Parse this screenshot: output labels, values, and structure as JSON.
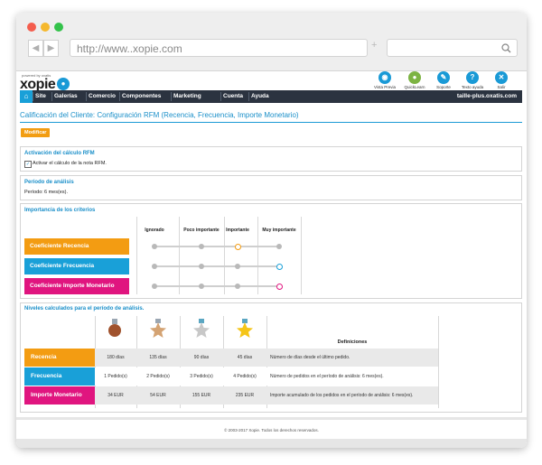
{
  "browser": {
    "url": "http://www..xopie.com",
    "traffic_colors": [
      "#f45d4d",
      "#f5b82d",
      "#33c24a"
    ]
  },
  "header": {
    "logo_small": "powered by oxatis",
    "logo": "xopie",
    "icons": [
      {
        "label": "Vista Previa",
        "icon": "preview-icon",
        "color": "#1a9ad6"
      },
      {
        "label": "QuickLearn",
        "icon": "user-icon",
        "color": "#7cb342"
      },
      {
        "label": "Soporte",
        "icon": "wrench-icon",
        "color": "#1a9ad6"
      },
      {
        "label": "Texto ayuda",
        "icon": "help-icon",
        "color": "#1a9ad6"
      },
      {
        "label": "Salir",
        "icon": "close-icon",
        "color": "#1a9ad6"
      }
    ]
  },
  "menu": {
    "items": [
      "Site",
      "Galerías",
      "Comercio",
      "Componentes",
      "Marketing",
      "Cuenta",
      "Ayuda"
    ],
    "site_name": "taille-plus.oxatis.com"
  },
  "page_title": "Calificación del Cliente: Configuración RFM (Recencia, Frecuencia, Importe Monetario)",
  "modify_button": "Modificar",
  "activation": {
    "title": "Activación del cálculo RFM",
    "checkbox_label": "Activar el cálculo de la nota RFM.",
    "checked": true
  },
  "period": {
    "title": "Período de análisis",
    "label": "Período:",
    "value": "6 mes(es)."
  },
  "importance": {
    "title": "Importancia de los criterios",
    "levels": [
      "Ignorado",
      "Poco importante",
      "Importante",
      "Muy importante"
    ],
    "criteria": [
      {
        "label": "Coeficiente Recencia",
        "color": "#f39c12",
        "selected_level": 2
      },
      {
        "label": "Coeficiente Frecuencia",
        "color": "#19a0d8",
        "selected_level": 3
      },
      {
        "label": "Coeficiente Importe Monetario",
        "color": "#e0157f",
        "selected_level": 3
      }
    ]
  },
  "levels": {
    "title": "Niveles calculados para el período de análisis.",
    "medals": [
      {
        "icon": "bronze-medal-icon",
        "color": "#a0522d"
      },
      {
        "icon": "bronze-star-icon",
        "color": "#d4a373"
      },
      {
        "icon": "silver-star-icon",
        "color": "#c8c8c8"
      },
      {
        "icon": "gold-star-icon",
        "color": "#f5c518"
      }
    ],
    "definitions_header": "Definiciones",
    "rows": [
      {
        "label": "Recencia",
        "color": "#f39c12",
        "values": [
          "180 días",
          "135 días",
          "90 días",
          "45 días"
        ],
        "definition": "Número de días desde el último pedido."
      },
      {
        "label": "Frecuencia",
        "color": "#19a0d8",
        "values": [
          "1 Pedido(s)",
          "2 Pedido(s)",
          "3 Pedido(s)",
          "4 Pedido(s)"
        ],
        "definition": "Número de pedidos en el período de análisis: 6 mes(es)."
      },
      {
        "label": "Importe Monetario",
        "color": "#e0157f",
        "values": [
          "34 EUR",
          "54 EUR",
          "155 EUR",
          "235 EUR"
        ],
        "definition": "Importe acumulado de los pedidos en el período de análisis: 6 mes(es)."
      }
    ]
  },
  "footer": "© 2003-2017 Xopie. Todos los derechos reservados."
}
